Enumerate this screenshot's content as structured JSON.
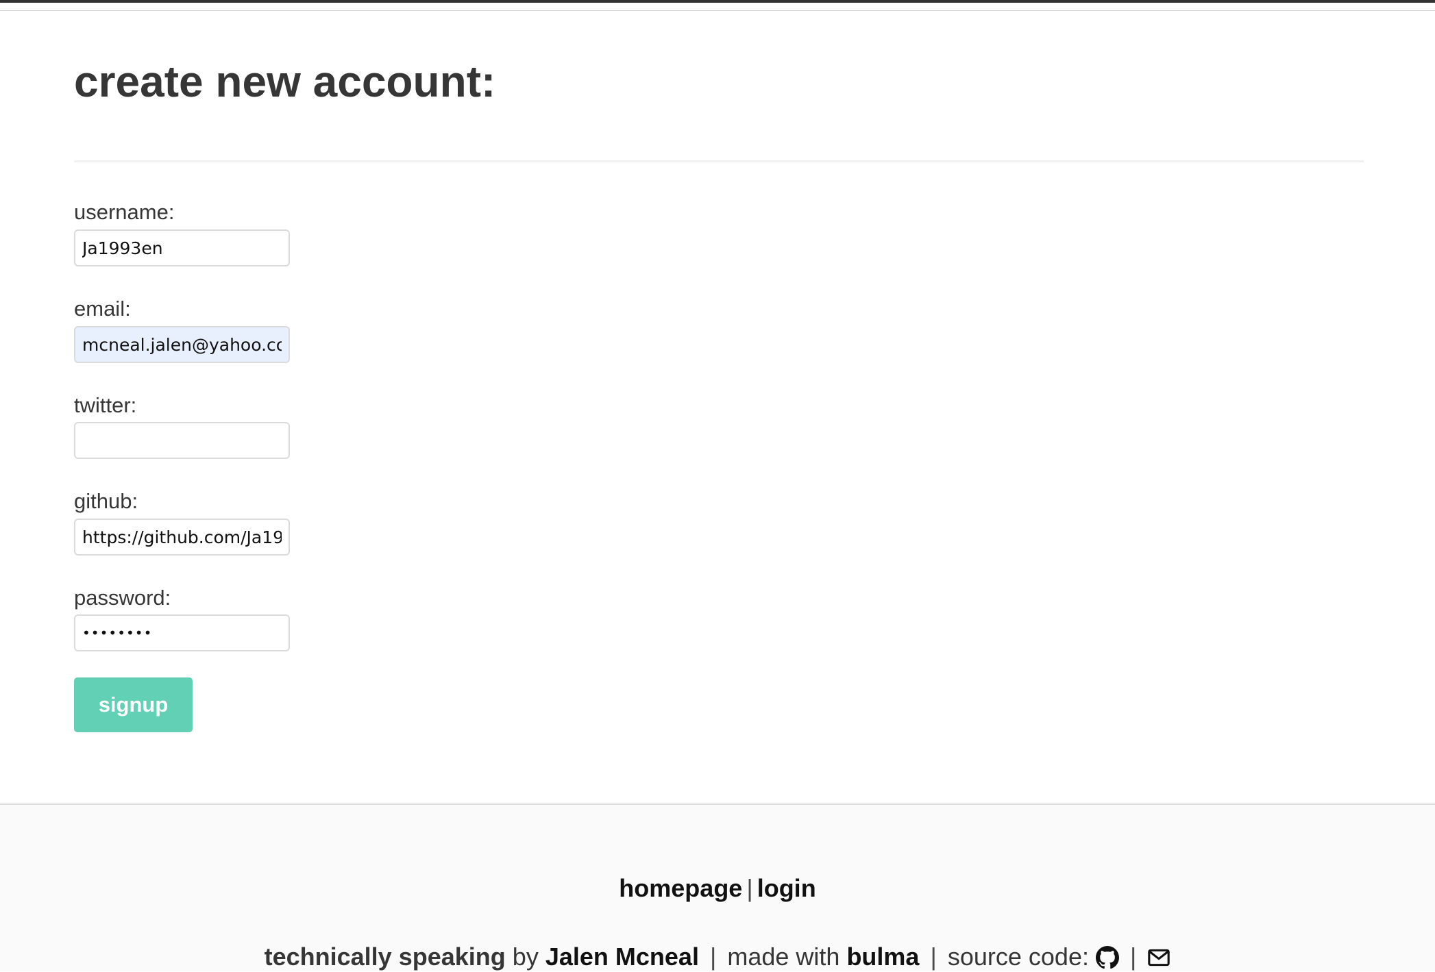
{
  "page": {
    "title": "create new account:"
  },
  "form": {
    "username": {
      "label": "username:",
      "value": "Ja1993en"
    },
    "email": {
      "label": "email:",
      "value": "mcneal.jalen@yahoo.co"
    },
    "twitter": {
      "label": "twitter:",
      "value": ""
    },
    "github": {
      "label": "github:",
      "value": "https://github.com/Ja19"
    },
    "password": {
      "label": "password:",
      "value": "••••••••"
    },
    "submit_label": "signup"
  },
  "footer": {
    "nav": {
      "homepage": "homepage",
      "separator": "|",
      "login": "login"
    },
    "credits": {
      "site_name": "technically speaking",
      "by": "by",
      "author": "Jalen Mcneal",
      "separator": "|",
      "made_with": "made with",
      "framework": "bulma",
      "source_code": "source code:"
    },
    "icons": [
      "github-icon",
      "envelope-icon"
    ]
  },
  "colors": {
    "accent": "#62d0b4",
    "text": "#363636",
    "autofill_bg": "#e8f0fe",
    "footer_bg": "#fafafa"
  }
}
